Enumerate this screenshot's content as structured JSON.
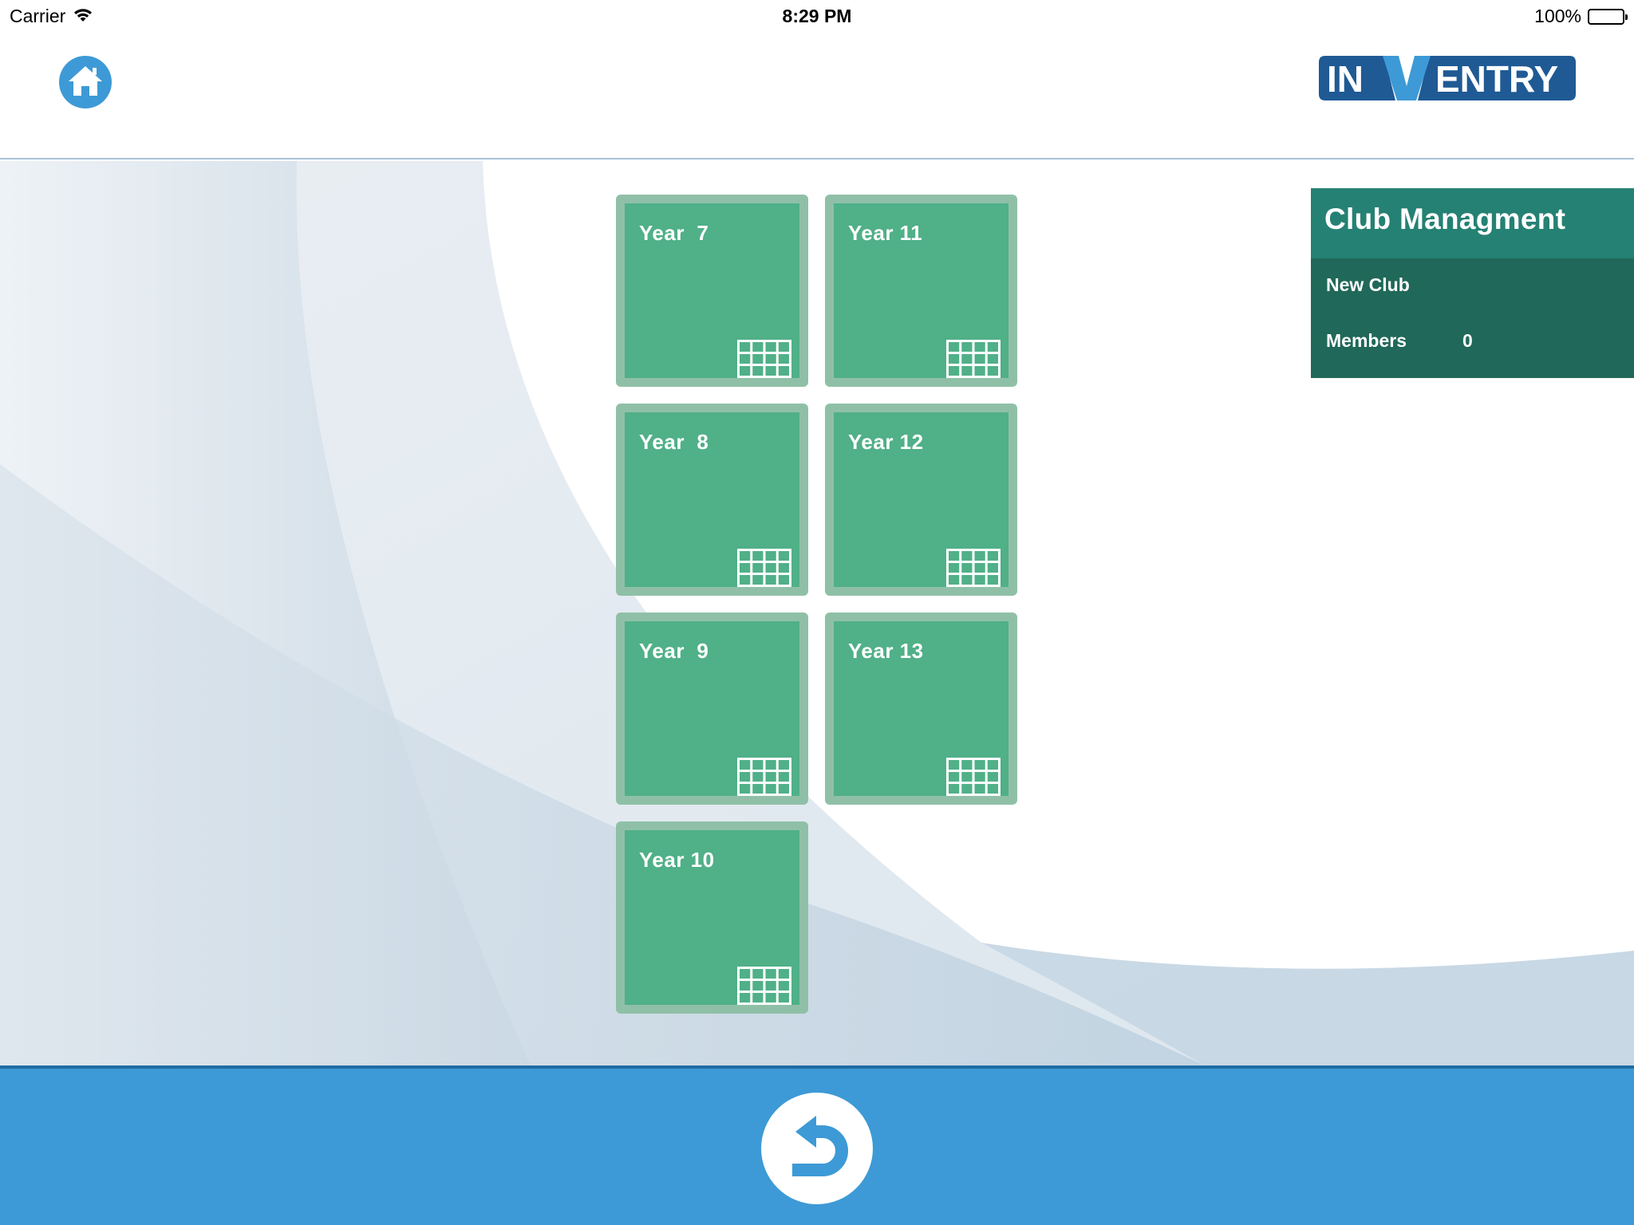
{
  "status_bar": {
    "carrier": "Carrier",
    "time": "8:29 PM",
    "battery": "100%",
    "battery_level": 1.0
  },
  "header": {
    "home_icon": "home-icon",
    "logo": {
      "left": "IN",
      "accent": "V",
      "right": "ENTRY"
    }
  },
  "colors": {
    "tile_bg": "#50b088",
    "tile_border": "#8fc0a7",
    "panel_header": "#258173",
    "panel_body": "#206859",
    "footer": "#3d9ad6",
    "logo_dark": "#1f5a94",
    "logo_accent": "#3d9ad6"
  },
  "tiles": [
    {
      "label": "Year  7",
      "icon": "grid-icon"
    },
    {
      "label": "Year  8",
      "icon": "grid-icon"
    },
    {
      "label": "Year  9",
      "icon": "grid-icon"
    },
    {
      "label": "Year 10",
      "icon": "grid-icon"
    },
    {
      "label": "Year 11",
      "icon": "grid-icon"
    },
    {
      "label": "Year 12",
      "icon": "grid-icon"
    },
    {
      "label": "Year 13",
      "icon": "grid-icon"
    }
  ],
  "panel": {
    "title": "Club Managment",
    "club_name": "New Club",
    "members_label": "Members",
    "members_value": "0"
  },
  "footer": {
    "undo_icon": "undo-icon"
  }
}
